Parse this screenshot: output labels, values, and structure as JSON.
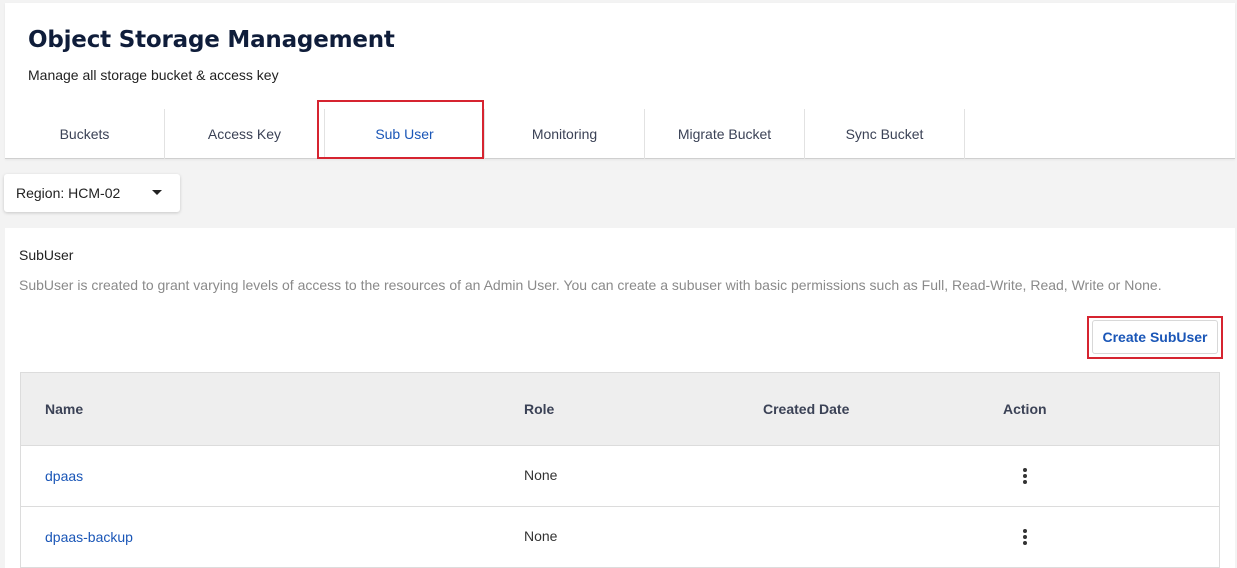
{
  "header": {
    "title": "Object Storage Management",
    "subtitle": "Manage all storage bucket & access key"
  },
  "tabs": [
    {
      "label": "Buckets",
      "active": false
    },
    {
      "label": "Access Key",
      "active": false
    },
    {
      "label": "Sub User",
      "active": true
    },
    {
      "label": "Monitoring",
      "active": false
    },
    {
      "label": "Migrate Bucket",
      "active": false
    },
    {
      "label": "Sync Bucket",
      "active": false
    }
  ],
  "region": {
    "label": "Region: HCM-02",
    "icon": "caret-down-icon"
  },
  "subuser": {
    "title": "SubUser",
    "description": "SubUser is created to grant varying levels of access to the resources of an Admin User. You can create a subuser with basic permissions such as Full, Read-Write, Read, Write or None.",
    "create_label": "Create SubUser"
  },
  "table": {
    "columns": [
      "Name",
      "Role",
      "Created Date",
      "Action"
    ],
    "rows": [
      {
        "name": "dpaas",
        "role": "None",
        "created_date": ""
      },
      {
        "name": "dpaas-backup",
        "role": "None",
        "created_date": ""
      }
    ]
  },
  "colors": {
    "accent": "#1a56b7",
    "highlight": "#d62430",
    "title": "#0f1d3a"
  }
}
